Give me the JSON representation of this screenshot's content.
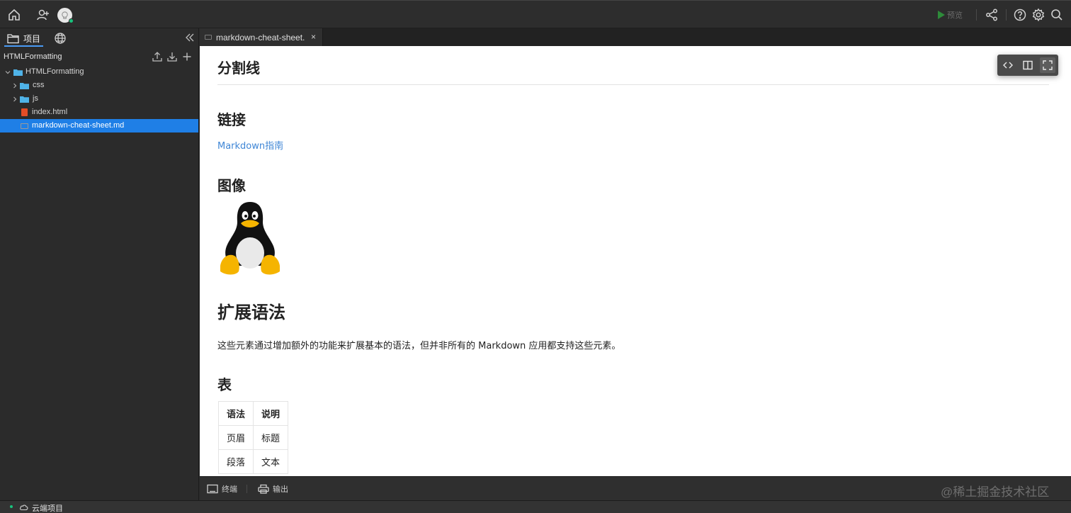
{
  "topbar": {
    "home_icon": "home-icon",
    "add_user_icon": "add-user-icon",
    "preview_label": "预览",
    "share_icon": "share-icon",
    "help_icon": "help-icon",
    "settings_icon": "gear-icon",
    "search_icon": "search-icon"
  },
  "sidebar": {
    "tab_project_label": "项目",
    "project_title": "HTMLFormatting",
    "tree": [
      {
        "label": "HTMLFormatting",
        "type": "folder",
        "expanded": true,
        "depth": 0
      },
      {
        "label": "css",
        "type": "folder",
        "expanded": false,
        "depth": 1
      },
      {
        "label": "js",
        "type": "folder",
        "expanded": false,
        "depth": 1
      },
      {
        "label": "index.html",
        "type": "html",
        "depth": 1
      },
      {
        "label": "markdown-cheat-sheet.md",
        "type": "md",
        "depth": 1,
        "selected": true
      }
    ]
  },
  "editor": {
    "tab_label": "markdown-cheat-sheet.",
    "tab_close": "×"
  },
  "content": {
    "h_hr": "分割线",
    "h_link": "链接",
    "link_text": "Markdown指南",
    "h_image": "图像",
    "h_extended": "扩展语法",
    "extended_para": "这些元素通过增加额外的功能来扩展基本的语法，但并非所有的 Markdown 应用都支持这些元素。",
    "h_table": "表",
    "table": {
      "headers": [
        "语法",
        "说明"
      ],
      "rows": [
        [
          "页眉",
          "标题"
        ],
        [
          "段落",
          "文本"
        ]
      ]
    }
  },
  "bottombar": {
    "terminal_label": "终端",
    "output_label": "输出",
    "watermark": "@稀土掘金技术社区"
  },
  "statusbar": {
    "label": "云端项目"
  },
  "colors": {
    "accent": "#1f7fe6",
    "link": "#3f86d6",
    "status_ok": "#19c37d",
    "html_icon": "#e44d26",
    "folder": "#4fb3e8"
  }
}
